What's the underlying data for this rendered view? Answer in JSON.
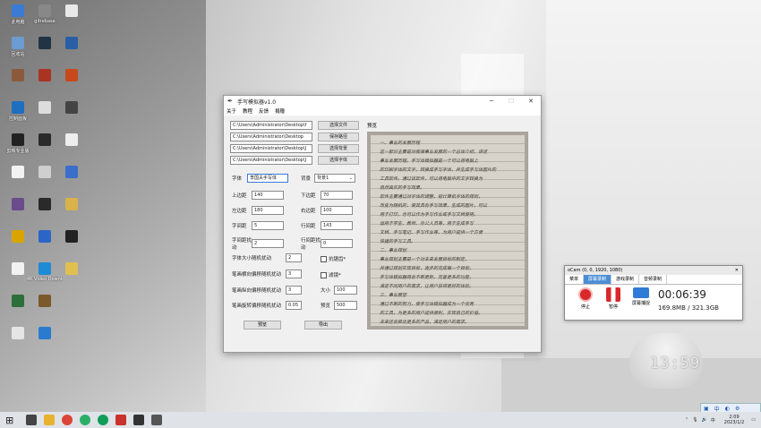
{
  "desktop_icons": [
    {
      "label": "此电脑",
      "color": "#3a7bd5"
    },
    {
      "label": "回收站",
      "color": "#6c9bd2"
    },
    {
      "label": "",
      "color": "#8b5a3c"
    },
    {
      "label": "控制面板",
      "color": "#1e6fc0"
    },
    {
      "label": "剪映专业版",
      "color": "#222222"
    },
    {
      "label": "",
      "color": "#f2f2f2"
    },
    {
      "label": "",
      "color": "#6a4c8c"
    },
    {
      "label": "",
      "color": "#d9a400"
    },
    {
      "label": "",
      "color": "#f2f2f2"
    },
    {
      "label": "",
      "color": "#2d6f3a"
    },
    {
      "label": "",
      "color": "#e6e6e6"
    },
    {
      "label": "gitrebase",
      "color": "#888888"
    },
    {
      "label": "",
      "color": "#223344"
    },
    {
      "label": "",
      "color": "#aa3322"
    },
    {
      "label": "",
      "color": "#dddddd"
    },
    {
      "label": "",
      "color": "#2a2a2a"
    },
    {
      "label": "",
      "color": "#cfcfcf"
    },
    {
      "label": "",
      "color": "#2a2a2a"
    },
    {
      "label": "",
      "color": "#2b65c7"
    },
    {
      "label": "4K Video Downloader",
      "color": "#1f8ad6"
    },
    {
      "label": "",
      "color": "#7a5a2a"
    },
    {
      "label": "",
      "color": "#2a7ad0"
    },
    {
      "label": "",
      "color": "#e8e8e8"
    },
    {
      "label": "",
      "color": "#2a5fa5"
    },
    {
      "label": "",
      "color": "#c74a1e"
    },
    {
      "label": "",
      "color": "#444444"
    },
    {
      "label": "",
      "color": "#eeeeee"
    },
    {
      "label": "",
      "color": "#3a6ec8"
    },
    {
      "label": "",
      "color": "#d9b24a"
    },
    {
      "label": "",
      "color": "#222222"
    },
    {
      "label": "",
      "color": "#e0c050"
    }
  ],
  "app": {
    "title": "手写模拟器v1.0",
    "menu": [
      "关于",
      "教程",
      "反馈",
      "捐赠"
    ],
    "paths": [
      {
        "value": "C:\\Users\\Administrator\\Desktop\\f",
        "button": "选择文件"
      },
      {
        "value": "C:\\Users\\Administrator\\Desktop",
        "button": "保存路径"
      },
      {
        "value": "C:\\Users\\Administrator\\Desktop\\J",
        "button": "选择背景"
      },
      {
        "value": "C:\\Users\\Administrator\\Desktop\\J",
        "button": "选择字体"
      }
    ],
    "font_label": "字体",
    "font_value": "李国夫手写体",
    "bg_label": "背景",
    "bg_value": "背景1",
    "fields_left": [
      {
        "label": "上边距",
        "value": "140"
      },
      {
        "label": "左边距",
        "value": "180"
      },
      {
        "label": "字间距",
        "value": "5"
      },
      {
        "label": "字间距扰动",
        "value": "2"
      }
    ],
    "fields_right": [
      {
        "label": "下边距",
        "value": "70"
      },
      {
        "label": "右边距",
        "value": "100"
      },
      {
        "label": "行间距",
        "value": "143"
      },
      {
        "label": "行间距扰动",
        "value": "0"
      }
    ],
    "perturb": [
      {
        "label": "字体大小随机扰动",
        "value": "2"
      },
      {
        "label": "笔画横向偏移随机扰动",
        "value": "3"
      },
      {
        "label": "笔画纵向偏移随机扰动",
        "value": "3"
      },
      {
        "label": "笔画旋转偏移随机扰动",
        "value": "0.05"
      }
    ],
    "checks": [
      "抗锯齿*",
      "滤镜*"
    ],
    "size_label": "大小",
    "size_value": "100",
    "preview_label": "预览",
    "preview_value": "500",
    "btn_preview": "预览",
    "btn_export": "导出",
    "preview_title": "预览",
    "handwriting": [
      "一、事业的发展历程",
      "  这一部分主要是对我律事业发展的一个总体介绍，讲述",
      "事业发展历程。手写体模拟器是一个可以将电脑上",
      "的印刷字体的文字，转换成手写字体，并生成手写体图片的",
      "工具软件。通过该软件，可以将电脑中的文字转换为",
      "自然真实的手写效果。",
      "  软件主要通过对字体的调整，把计算机字体的规则，",
      "改变为随机的，使其具有手写效果，生成的图片，可以",
      "用于打印，也可以作为手写作业或手写文档使用。",
      "  适用于学生、教师、办公人员等，用于生成手写",
      "文档、手写笔记、手写作业等，为用户提供一个方便",
      "快捷的手写工具。",
      "二、事业规划",
      "  事业规划主要是一个对未来发展目标的制定，",
      "并通过规划实现目标，逐步的完成每一个目标。",
      "  手写体模拟器将会不断更新，完善更多的功能，",
      "满足不同用户的需求，让用户获得更好的体验。",
      "三、事业展望",
      "  通过不断的努力，使手写体模拟器成为一个优秀",
      "的工具，为更多的用户提供便利，实现自己的价值。",
      "  未来还会推出更多的产品，满足用户的需求。"
    ]
  },
  "ocam": {
    "title": "oCam (0, 0, 1920, 1080)",
    "tabs": [
      "菜单",
      "屏幕录制",
      "游戏录制",
      "音频录制"
    ],
    "controls": [
      "停止",
      "暂停",
      "屏幕捕捉"
    ],
    "elapsed": "00:06:39",
    "size": "169.8MB / 321.3GB"
  },
  "taskbar": {
    "time": "2:09",
    "date": "2023/1/2",
    "ime": "中",
    "apps": [
      {
        "name": "search",
        "color": "#444444"
      },
      {
        "name": "explorer",
        "color": "#e8b230"
      },
      {
        "name": "chrome",
        "color": "#db4437"
      },
      {
        "name": "wechat",
        "color": "#2aae67"
      },
      {
        "name": "chrome2",
        "color": "#0f9d58"
      },
      {
        "name": "wps",
        "color": "#c8322a"
      },
      {
        "name": "app7",
        "color": "#333333"
      },
      {
        "name": "app8",
        "color": "#555555"
      }
    ]
  },
  "speaker_clock": "13:59"
}
